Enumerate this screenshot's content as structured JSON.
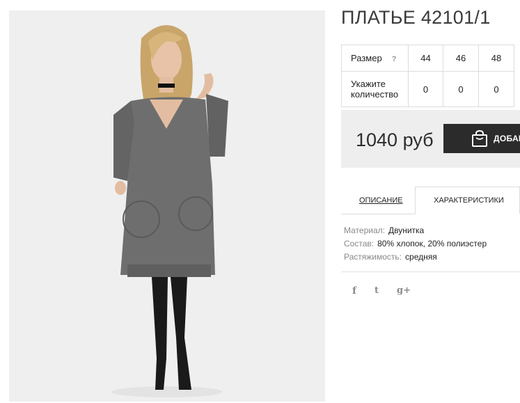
{
  "product": {
    "title": "ПЛАТЬЕ 42101/1",
    "image_alt": "Девушка в сером платье и черных ботфортах"
  },
  "size_table": {
    "size_label": "Размер",
    "help_glyph": "?",
    "sizes": [
      "44",
      "46",
      "48"
    ],
    "quantity_label_line1": "Укажите",
    "quantity_label_line2": "количество",
    "quantities": [
      "0",
      "0",
      "0"
    ]
  },
  "price_block": {
    "price": "1040 руб",
    "add_button_label": "ДОБАВИТЬ",
    "bag_icon": "shopping-bag-icon"
  },
  "tabs": [
    {
      "label": "ОПИСАНИЕ",
      "active": false
    },
    {
      "label": "ХАРАКТЕРИСТИКИ",
      "active": true
    }
  ],
  "characteristics": [
    {
      "key": "Материал:",
      "value": "Двунитка"
    },
    {
      "key": "Состав:",
      "value": "80% хлопок, 20% полиэстер"
    },
    {
      "key": "Растяжимость:",
      "value": "средняя"
    }
  ],
  "social": {
    "facebook": "f",
    "twitter": "t",
    "googleplus": "g+"
  },
  "colors": {
    "button_bg": "#2b2b2b",
    "price_bg": "#eeeeee",
    "dress": "#6e6e6e",
    "boots": "#1a1a1a"
  }
}
